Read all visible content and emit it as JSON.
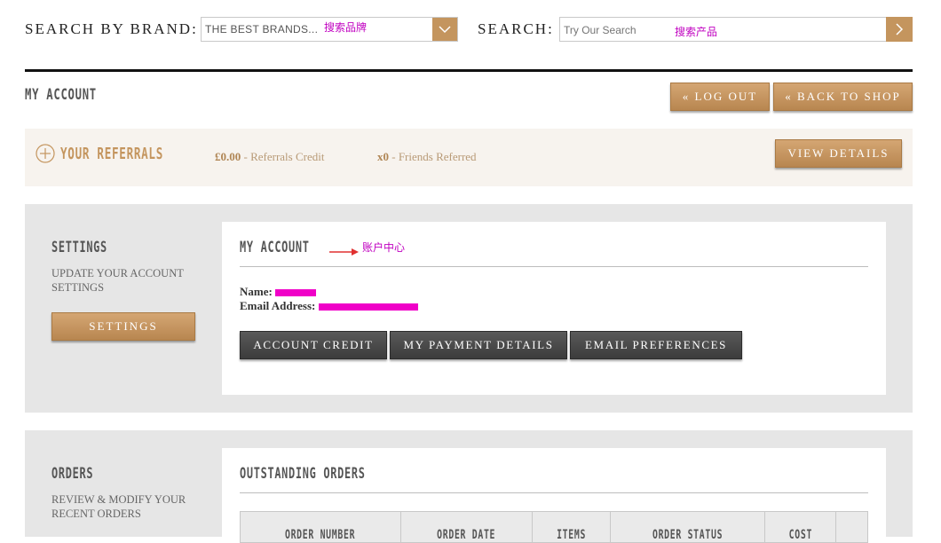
{
  "header": {
    "brand_label": "SEARCH BY BRAND:",
    "brand_value": "THE BEST BRANDS...",
    "brand_annotation": "搜索品牌",
    "search_label": "SEARCH:",
    "search_placeholder": "Try Our Search",
    "search_annotation": "搜索产品"
  },
  "page": {
    "title": "MY ACCOUNT",
    "logout_label": "« LOG OUT",
    "back_label": "« BACK TO SHOP"
  },
  "referrals": {
    "title": "YOUR REFERRALS",
    "credit_value": "£0.00",
    "credit_label": " - Referrals Credit",
    "friends_value": "x0",
    "friends_label": " - Friends Referred",
    "view_label": "VIEW DETAILS"
  },
  "settings": {
    "title": "SETTINGS",
    "description": "UPDATE YOUR ACCOUNT SETTINGS",
    "button_label": "SETTINGS"
  },
  "account": {
    "title": "MY ACCOUNT",
    "annotation": "账户中心",
    "name_label": "Name:",
    "email_label": "Email Address:",
    "buttons": [
      "ACCOUNT CREDIT",
      "MY PAYMENT DETAILS",
      "EMAIL PREFERENCES"
    ]
  },
  "orders": {
    "title": "ORDERS",
    "description": "REVIEW & MODIFY YOUR RECENT ORDERS",
    "outstanding_title": "OUTSTANDING ORDERS",
    "columns": [
      "ORDER NUMBER",
      "ORDER DATE",
      "ITEMS",
      "ORDER STATUS",
      "COST",
      ""
    ]
  },
  "colors": {
    "gold": "#c4955e",
    "annotation": "#c000c0",
    "redaction": "#f000c8"
  }
}
